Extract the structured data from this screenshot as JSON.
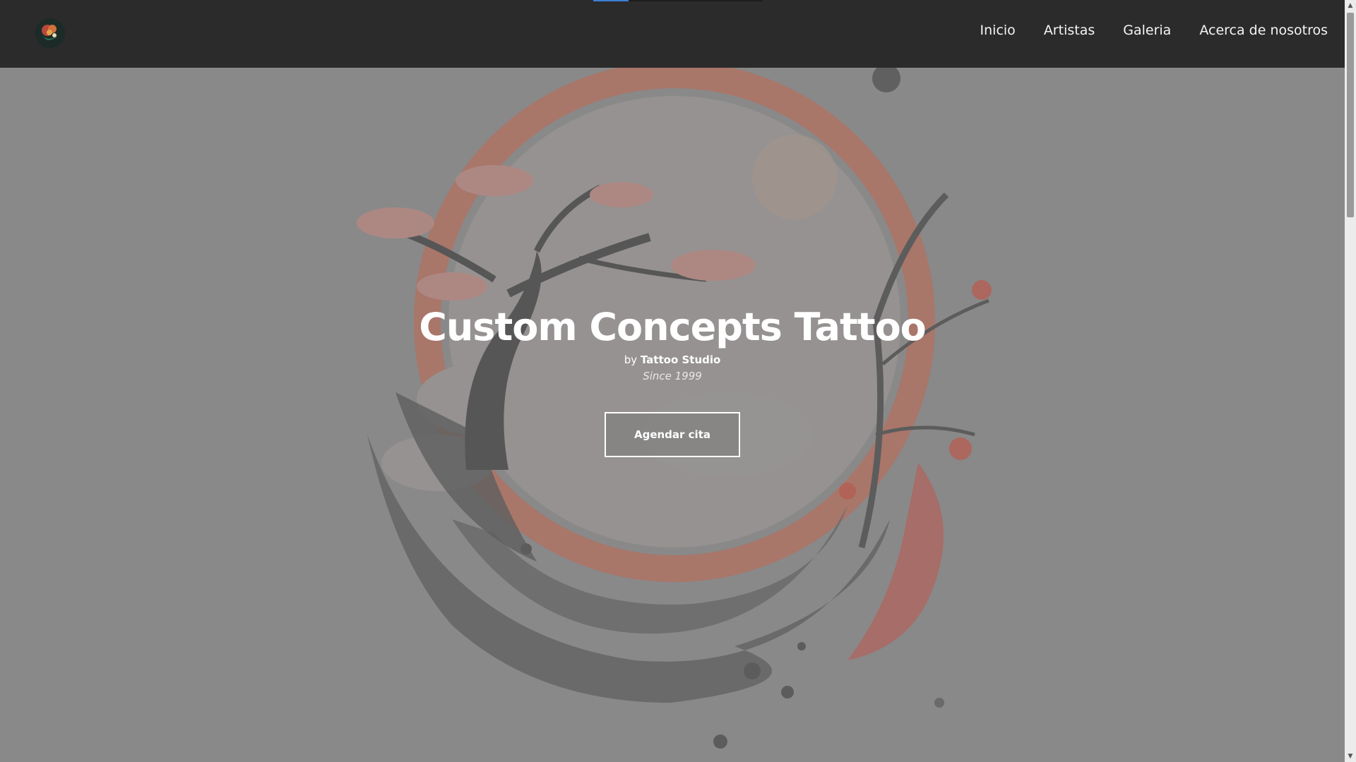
{
  "nav": {
    "logo_icon": "rose-skull-logo-icon",
    "links": [
      "Inicio",
      "Artistas",
      "Galeria",
      "Acerca de nosotros"
    ]
  },
  "hero": {
    "title": "Custom Concepts Tattoo",
    "byline_prefix": "by",
    "byline_name": "Tattoo Studio",
    "since": "Since 1999",
    "cta_label": "Agendar cita",
    "art_icon": "japanese-tree-moon-wave-artwork"
  },
  "colors": {
    "navbar": "#2b2b2b",
    "hero_bg": "#8b8b8b",
    "accent_red": "#c0574a",
    "active_indicator": "#3d7fd6"
  }
}
